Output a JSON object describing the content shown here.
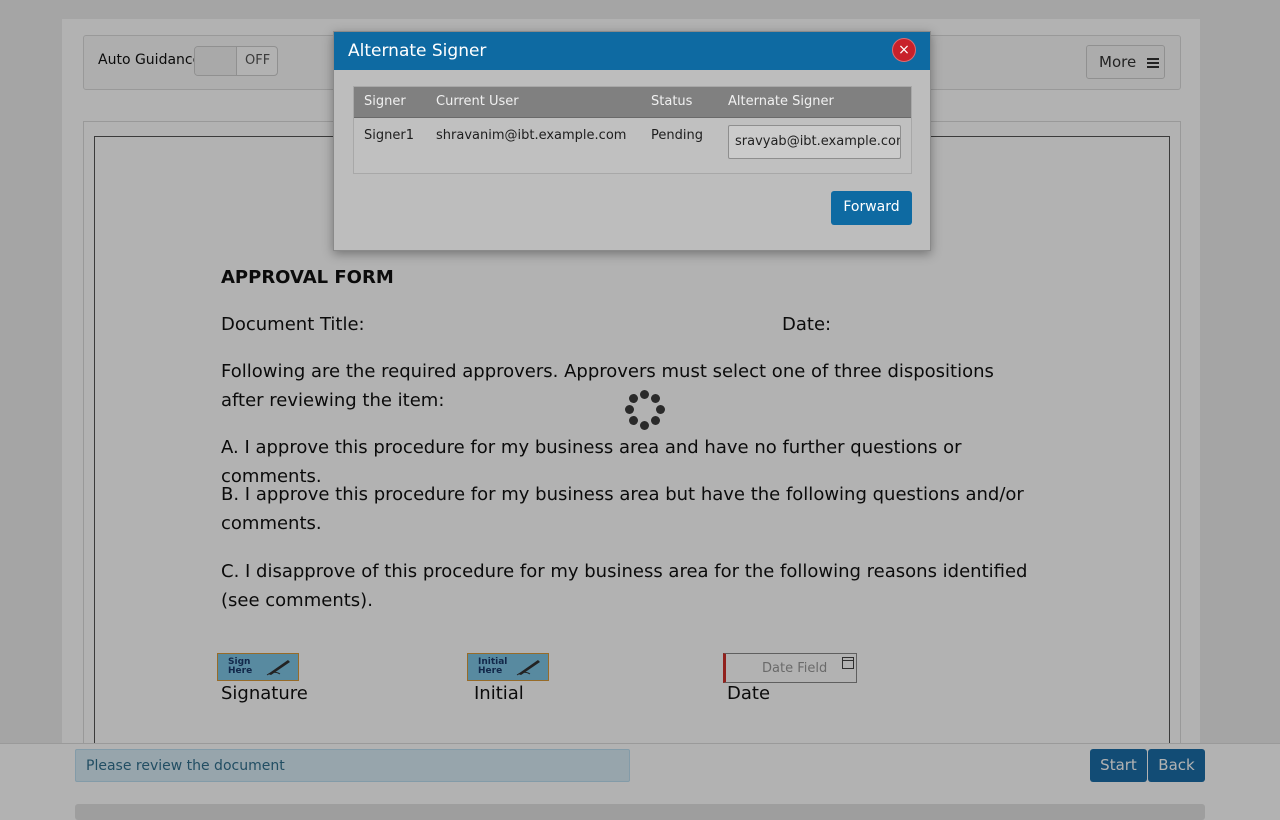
{
  "toolbar": {
    "auto_guidance_label": "Auto Guidance",
    "toggle_state": "OFF",
    "more_label": "More"
  },
  "document": {
    "form_title": "APPROVAL FORM",
    "doc_title_label": "Document Title:",
    "date_label": "Date:",
    "instructions": "Following are the required approvers. Approvers must select one of three dispositions after reviewing the item:",
    "option_a": "A. I approve this procedure for my business area and have no further questions or comments.",
    "option_b": "B. I approve this procedure for my business area but have the following questions and/or comments.",
    "option_c": "C. I disapprove of this procedure for my business area for the following reasons identified (see comments).",
    "signature_field_text": "Sign Here",
    "initial_field_text": "Initial Here",
    "date_field_placeholder": "Date Field",
    "signature_label": "Signature",
    "initial_label": "Initial",
    "date_caption": "Date"
  },
  "footer": {
    "status_message": "Please review the document",
    "start_label": "Start",
    "back_label": "Back"
  },
  "modal": {
    "title": "Alternate Signer",
    "close_glyph": "×",
    "table": {
      "headers": [
        "Signer",
        "Current User",
        "Status",
        "Alternate Signer"
      ],
      "rows": [
        {
          "signer": "Signer1",
          "current_user": "shravanim@ibt.example.com",
          "status": "Pending",
          "alternate_signer": "sravyab@ibt.example.com"
        }
      ]
    },
    "forward_label": "Forward"
  },
  "colors": {
    "header_blue": "#0e6aa2",
    "close_red": "#c8202a",
    "button_blue": "#1b6ea8"
  }
}
